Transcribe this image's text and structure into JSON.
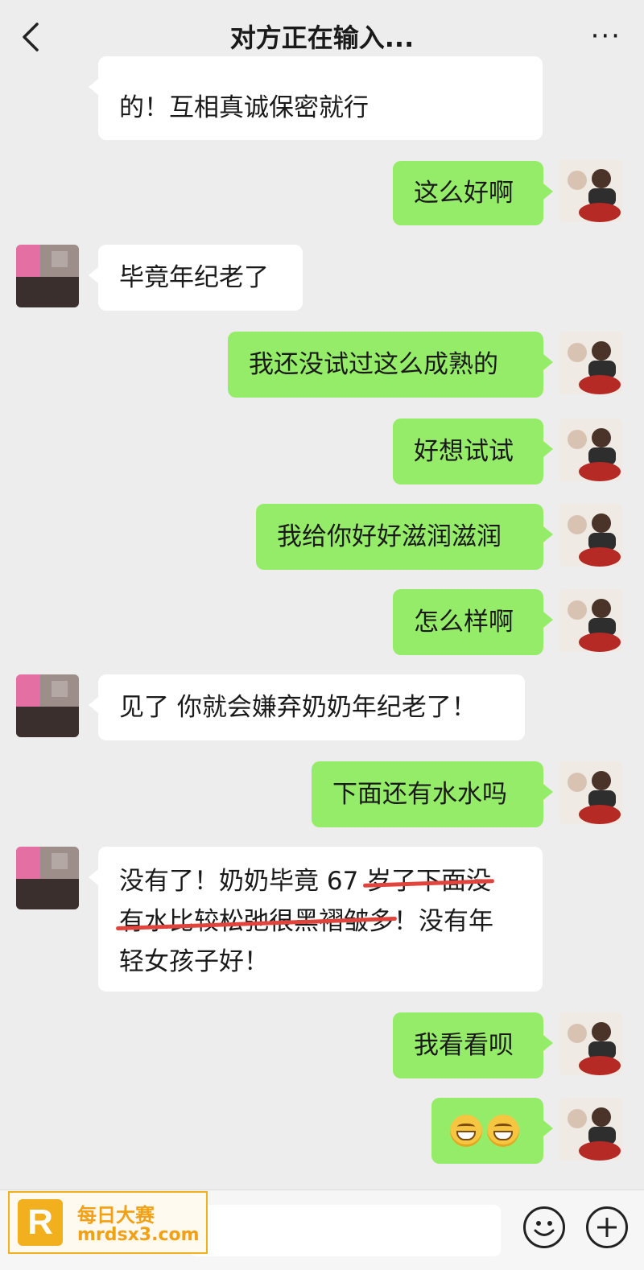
{
  "header": {
    "title": "对方正在输入...",
    "back_icon": "chevron-left-icon",
    "more_label": "···"
  },
  "messages": [
    {
      "side": "in",
      "lines": [
        "的！互相真诚保密就行"
      ]
    },
    {
      "side": "out",
      "text": "这么好啊"
    },
    {
      "side": "in",
      "text": "毕竟年纪老了"
    },
    {
      "side": "out",
      "text": "我还没试过这么成熟的"
    },
    {
      "side": "out",
      "text": "好想试试"
    },
    {
      "side": "out",
      "text": "我给你好好滋润滋润"
    },
    {
      "side": "out",
      "text": "怎么样啊"
    },
    {
      "side": "in",
      "text": "见了 你就会嫌弃奶奶年纪老了！"
    },
    {
      "side": "out",
      "text": "下面还有水水吗"
    },
    {
      "side": "in",
      "line1_plain": "没有了！奶奶毕竟 67 ",
      "line1_struck": "岁了下面没",
      "line2_struck": "有水比较松弛很黑褶皱多",
      "line2_plain": "！没有年",
      "line3_plain": "轻女孩子好！"
    },
    {
      "side": "out",
      "text": "我看看呗"
    },
    {
      "side": "out",
      "emoji": [
        "grin-emoji",
        "grin-emoji"
      ]
    }
  ],
  "input_bar": {
    "emoji_button_icon": "smiley-icon",
    "plus_button_icon": "plus-icon"
  },
  "watermark": {
    "logo_letter": "R",
    "line1": "每日大赛",
    "line2": "mrdsx3.com",
    "accent": "#f2b01e"
  },
  "colors": {
    "background": "#ededed",
    "bubble_out": "#95ec69",
    "bubble_in": "#ffffff",
    "strike": "#e0443c"
  }
}
